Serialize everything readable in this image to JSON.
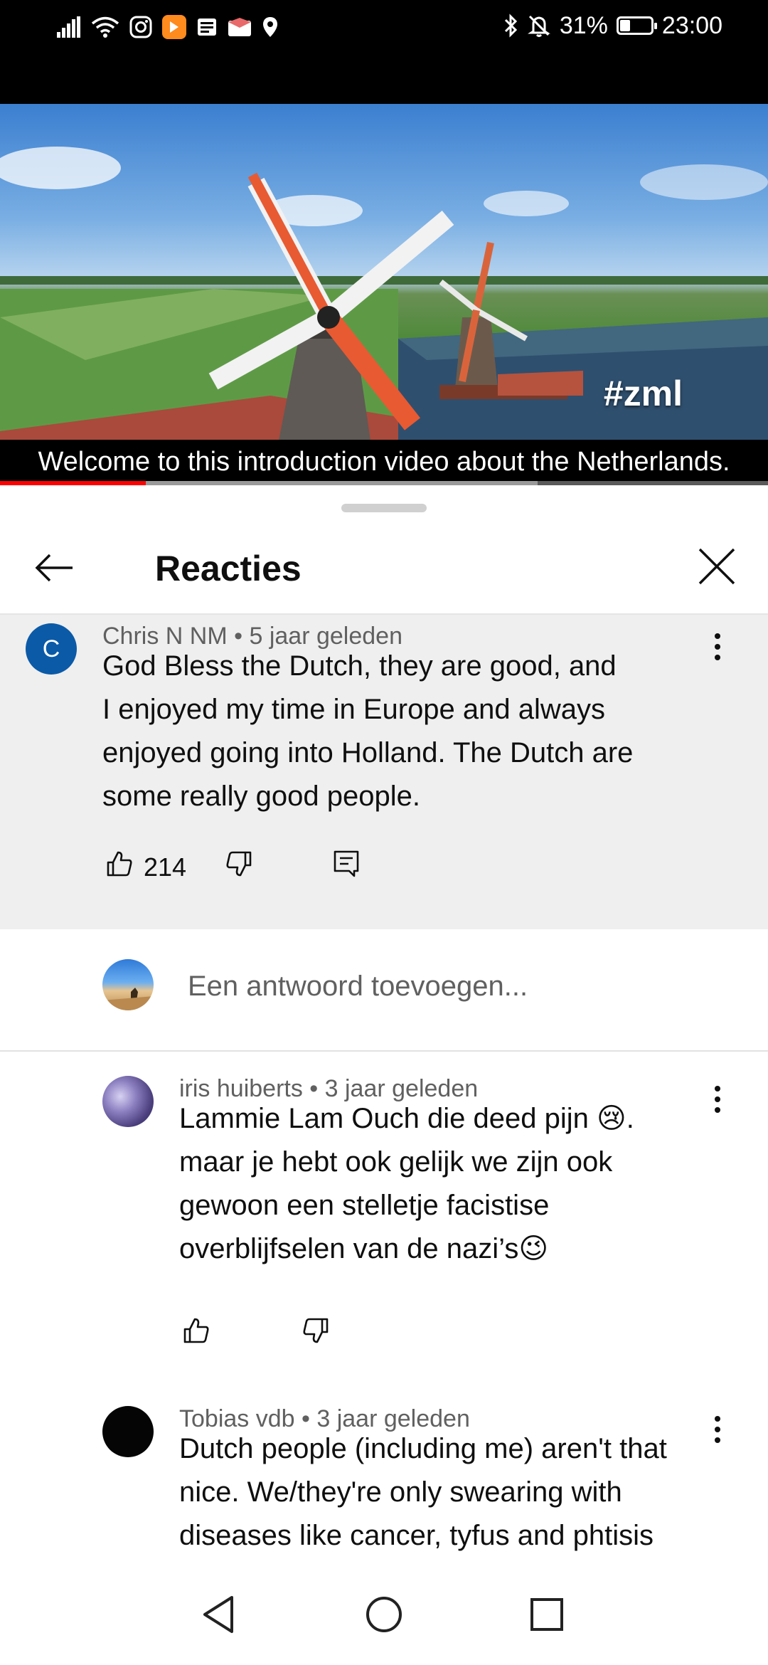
{
  "status_bar": {
    "battery_percent": "31%",
    "battery_level": 0.31,
    "time": "23:00",
    "icons_left": [
      "signal-icon",
      "wifi-icon",
      "instagram-icon",
      "orange-app-icon",
      "news-icon",
      "mail-app-icon",
      "location-icon"
    ],
    "icons_right": [
      "bluetooth-icon",
      "mute-icon",
      "battery-icon"
    ]
  },
  "video": {
    "overlay_tag": "#zml",
    "subtitle": "Welcome to this introduction video about the Netherlands.",
    "progress_played": 0.19,
    "progress_buffered": 0.7,
    "accent_color": "#ff0000"
  },
  "sheet": {
    "title": "Reacties",
    "back_icon": "arrow-left-icon",
    "close_icon": "close-icon"
  },
  "top_comment": {
    "avatar_letter": "C",
    "avatar_color": "#0b5aa8",
    "author": "Chris N NM",
    "age": "5 jaar geleden",
    "text": "God Bless the Dutch, they are good, and\nI enjoyed my time in Europe and always\nenjoyed going into Holland.  The Dutch are\nsome really good people.",
    "likes": "214"
  },
  "reply_input": {
    "placeholder": "Een antwoord toevoegen..."
  },
  "replies": [
    {
      "author": "iris huiberts",
      "age": "3 jaar geleden",
      "text": "Lammie Lam Ouch die deed pijn 😢.\nmaar je hebt ook gelijk we zijn ook\ngewoon een stelletje facistise\noverblijfselen van de nazi’s😉"
    },
    {
      "author": "Tobias vdb",
      "age": "3 jaar geleden",
      "text": "Dutch people (including me) aren't that\nnice. We/they're only swearing with\ndiseases like cancer, tyfus and phtisis"
    }
  ],
  "meta_separator": " • ",
  "navbar": {
    "icons": [
      "back-triangle-icon",
      "home-circle-icon",
      "recents-square-icon"
    ]
  }
}
